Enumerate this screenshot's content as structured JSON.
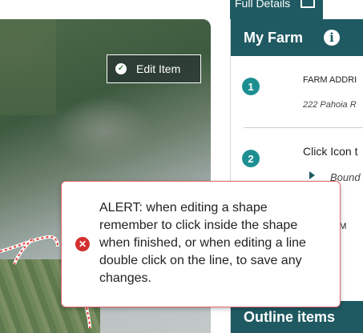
{
  "top_bar": {
    "full_details_label": "Full Details",
    "external_link_icon": "external-link-icon"
  },
  "map": {
    "edit_item_label": "Edit Item",
    "edit_icon": "check-circle-icon"
  },
  "panel": {
    "title": "My Farm",
    "info_icon": "info-icon",
    "steps": [
      {
        "number": "1",
        "heading": "FARM ADDRI",
        "value": "222 Pahoia R"
      },
      {
        "number": "2",
        "heading": "Click Icon t",
        "item_label": "Bound"
      }
    ],
    "partial_label": "ARM",
    "outline_label": "Outline items"
  },
  "alert": {
    "icon": "error-x-icon",
    "message": "ALERT: when editing a shape remember to click inside the shape when finished, or when editing a line double click on the line, to save any changes."
  },
  "colors": {
    "header_teal": "#1f5a62",
    "step_teal": "#1e8f91",
    "alert_border": "#e0686e",
    "error_red": "#d32f2f",
    "line_red": "#e53935"
  }
}
